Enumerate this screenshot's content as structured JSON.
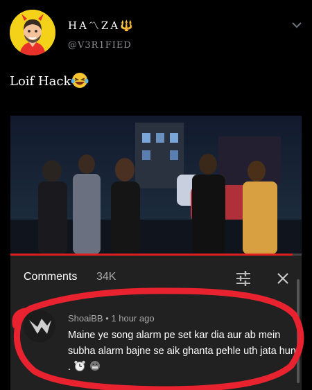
{
  "tweet": {
    "display_name": "HA〽ZA🔱",
    "handle": "@V3R1FIED",
    "text": "Loif Hack"
  },
  "video": {
    "progress_fraction": 0.97
  },
  "comments": {
    "title": "Comments",
    "count": "34K",
    "comment": {
      "author": "ShoaiBB",
      "time": "1 hour ago",
      "text": "Maine ye song alarm pe set kar dia aur ab mein subha alarm bajne se aik ghanta pehle uth jata hun ."
    }
  },
  "icons": [
    "devil-avatar-icon",
    "chevron-down-icon",
    "laughing-emoji-icon",
    "sort-sliders-icon",
    "close-icon",
    "alarm-clock-icon",
    "grimace-emoji-icon"
  ],
  "colors": {
    "accent_red": "#e01e1e",
    "panel_bg": "#212121",
    "annotation": "#e8232f"
  }
}
